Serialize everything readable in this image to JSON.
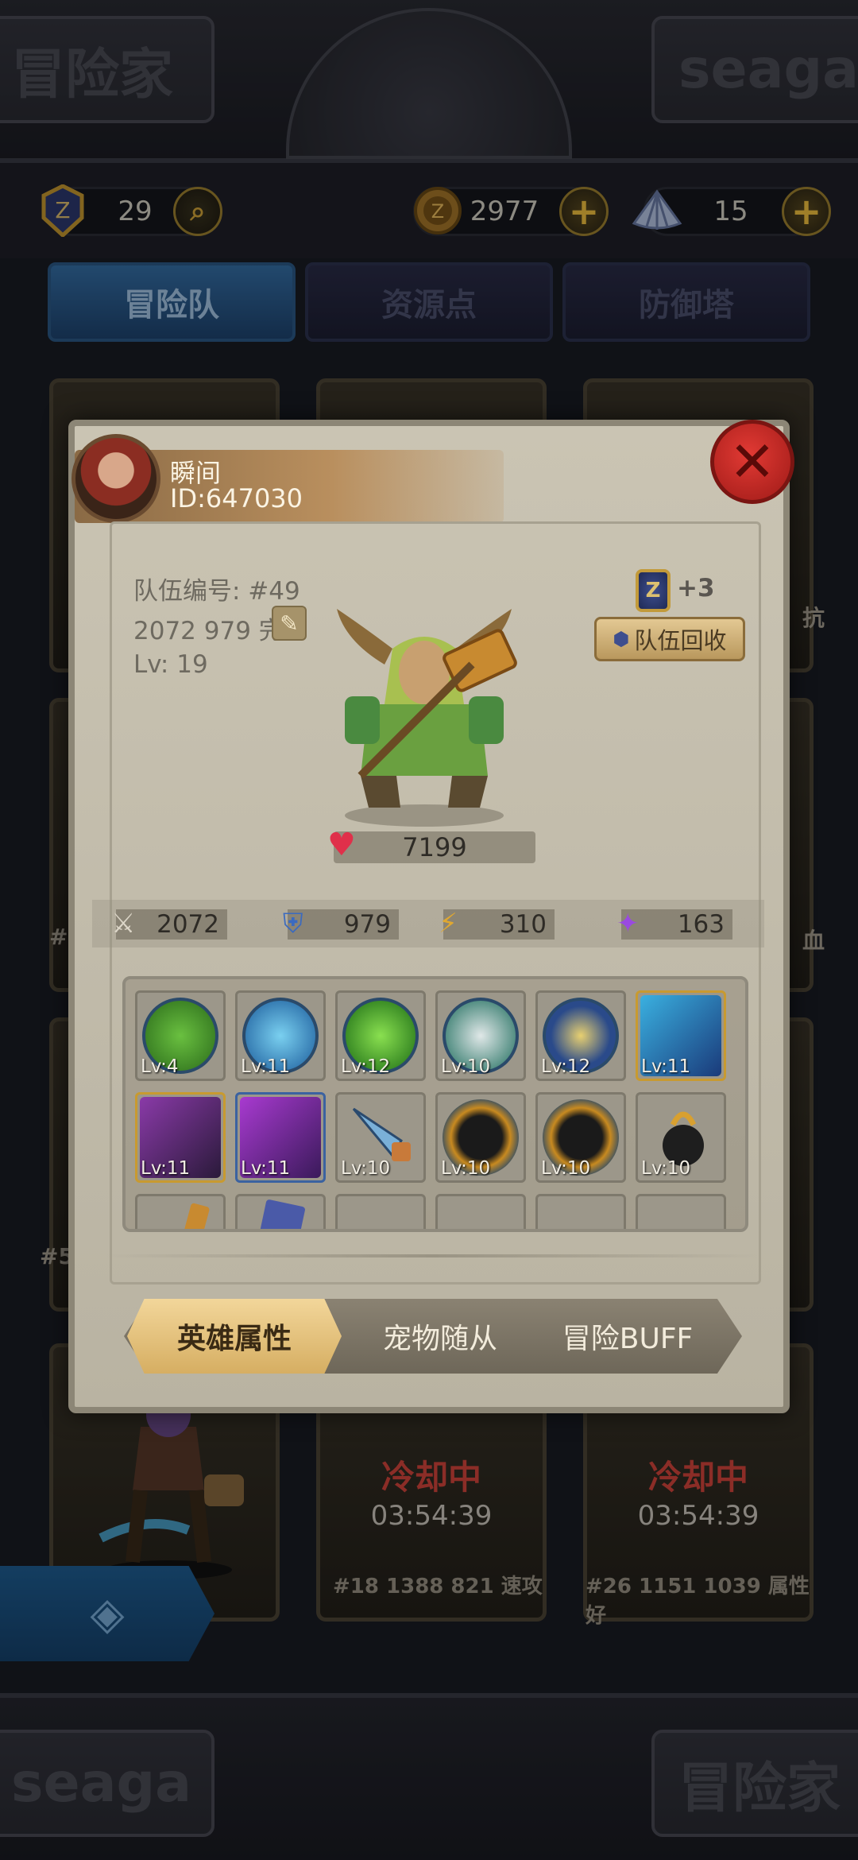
{
  "top_banner": {
    "left_text": "冒险家",
    "right_text": "seaga"
  },
  "resources": {
    "badge_count": "29",
    "coin_count": "2977",
    "shell_count": "15"
  },
  "tabs": [
    {
      "label": "冒险队",
      "active": true
    },
    {
      "label": "资源点",
      "active": false
    },
    {
      "label": "防御塔",
      "active": false
    }
  ],
  "background_cards": {
    "side_text_1": "抗",
    "side_text_2": "血",
    "side_text_3": "#",
    "side_text_4": "#5",
    "cooldown_label": "冷却中",
    "cooldown_time": "03:54:39",
    "card_caption_1": "#18 1388 821 速攻",
    "card_caption_2": "#26 1151 1039 属性好"
  },
  "bottom_banner": {
    "left_text": "seaga",
    "right_text": "冒险家"
  },
  "dialog": {
    "player_name": "瞬间",
    "player_id": "ID:647030",
    "close_glyph": "✕",
    "team_number": "队伍编号: #49",
    "team_stats": "2072 979 完",
    "team_level": "Lv: 19",
    "reward_count": "+3",
    "recycle_label": "队伍回收",
    "hp": "7199",
    "stats": {
      "attack": "2072",
      "defense": "979",
      "speed": "310",
      "magic": "163"
    },
    "items": [
      {
        "lv": "Lv:4",
        "color": "#3b8a2c"
      },
      {
        "lv": "Lv:11",
        "color": "#2a78b8"
      },
      {
        "lv": "Lv:12",
        "color": "#2f8a2a"
      },
      {
        "lv": "Lv:10",
        "color": "#2c7a6a"
      },
      {
        "lv": "Lv:12",
        "color": "#2a5a9a"
      },
      {
        "lv": "Lv:11",
        "color": "#2b6fa8"
      },
      {
        "lv": "Lv:11",
        "color": "#5a2c6a"
      },
      {
        "lv": "Lv:11",
        "color": "#6a2c9a"
      },
      {
        "lv": "Lv:10",
        "color": "#2a4a6e"
      },
      {
        "lv": "Lv:10",
        "color": "#3a2a1a"
      },
      {
        "lv": "Lv:10",
        "color": "#3a2a1a"
      },
      {
        "lv": "Lv:10",
        "color": "#4a3a22"
      }
    ],
    "bottom_tabs": [
      {
        "label": "英雄属性",
        "active": true
      },
      {
        "label": "宠物随从",
        "active": false
      },
      {
        "label": "冒险BUFF",
        "active": false
      }
    ]
  }
}
